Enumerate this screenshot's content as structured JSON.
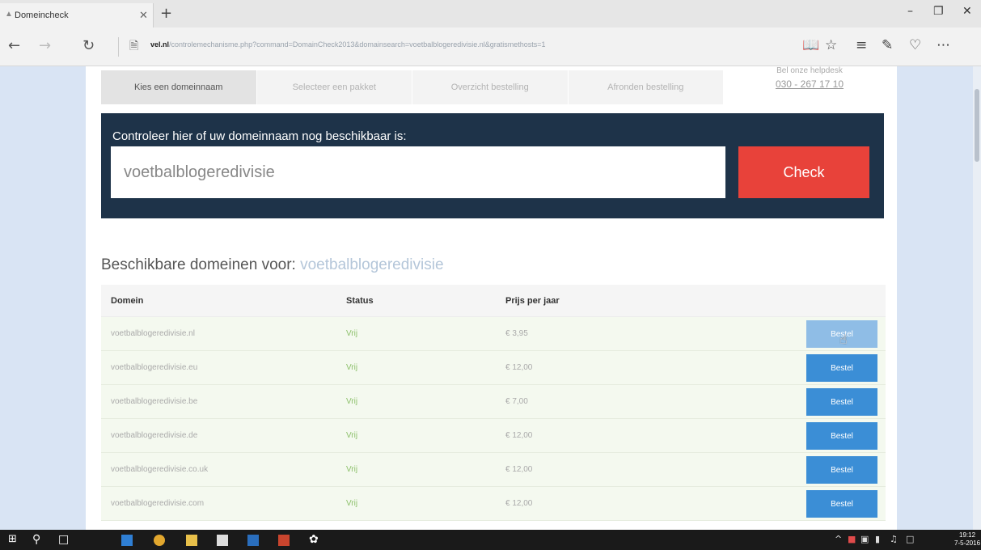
{
  "browser": {
    "tab_title": "Domeincheck",
    "url_domain": "vel.nl",
    "url_path": "/controlemechanisme.php?command=DomainCheck2013&domainsearch=voetbalblogeredivisie.nl&gratismethosts=1"
  },
  "steps": [
    {
      "label": "Kies een domeinnaam"
    },
    {
      "label": "Selecteer een pakket"
    },
    {
      "label": "Overzicht bestelling"
    },
    {
      "label": "Afronden bestelling"
    }
  ],
  "helpdesk": {
    "label": "Bel onze helpdesk",
    "phone": "030 - 267 17 10"
  },
  "check": {
    "label": "Controleer hier of uw domeinnaam nog beschikbaar is:",
    "value": "voetbalblogeredivisie",
    "button": "Check"
  },
  "results": {
    "title": "Beschikbare domeinen voor:",
    "query": "voetbalblogeredivisie",
    "columns": [
      "Domein",
      "Status",
      "Prijs per jaar"
    ],
    "rows": [
      {
        "domain": "voetbalblogeredivisie.nl",
        "status": "Vrij",
        "price": "€ 3,95",
        "action": "Bestel"
      },
      {
        "domain": "voetbalblogeredivisie.eu",
        "status": "Vrij",
        "price": "€ 12,00",
        "action": "Bestel"
      },
      {
        "domain": "voetbalblogeredivisie.be",
        "status": "Vrij",
        "price": "€ 7,00",
        "action": "Bestel"
      },
      {
        "domain": "voetbalblogeredivisie.de",
        "status": "Vrij",
        "price": "€ 12,00",
        "action": "Bestel"
      },
      {
        "domain": "voetbalblogeredivisie.co.uk",
        "status": "Vrij",
        "price": "€ 12,00",
        "action": "Bestel"
      },
      {
        "domain": "voetbalblogeredivisie.com",
        "status": "Vrij",
        "price": "€ 12,00",
        "action": "Bestel"
      }
    ]
  },
  "taskbar": {
    "clock_time": "19:12",
    "clock_date": "7-5-2016"
  },
  "colors": {
    "check_panel": "#1e3349",
    "check_button": "#e8423a",
    "bestel_button": "#3b8ed6",
    "status_free": "#8cc06a"
  }
}
